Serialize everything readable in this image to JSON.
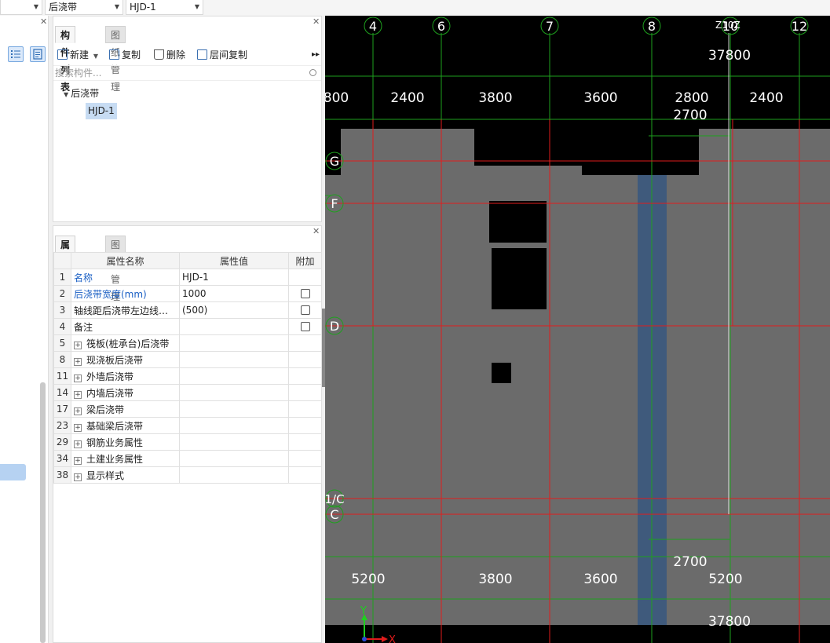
{
  "topbar": {
    "dropdown1": "",
    "dropdown2": "后浇带",
    "dropdown3": "HJD-1"
  },
  "component_panel": {
    "tabs": [
      "构件列表",
      "图纸管理"
    ],
    "toolbar": {
      "new_label": "新建",
      "copy_label": "复制",
      "delete_label": "删除",
      "floor_copy_label": "层间复制"
    },
    "search_placeholder": "搜索构件...",
    "tree_root": "后浇带",
    "tree_child": "HJD-1"
  },
  "property_panel": {
    "tabs": [
      "属性列表",
      "图层管理"
    ],
    "headers": [
      "属性名称",
      "属性值",
      "附加"
    ],
    "rows": [
      {
        "num": "1",
        "name": "名称",
        "value": "HJD-1",
        "checkbox": false,
        "expand": false,
        "blue": true
      },
      {
        "num": "2",
        "name": "后浇带宽度(mm)",
        "value": "1000",
        "checkbox": true,
        "expand": false,
        "blue": true
      },
      {
        "num": "3",
        "name": "轴线距后浇带左边线距...",
        "value": "(500)",
        "checkbox": true,
        "expand": false,
        "blue": false
      },
      {
        "num": "4",
        "name": "备注",
        "value": "",
        "checkbox": true,
        "expand": false,
        "blue": false
      },
      {
        "num": "5",
        "name": "筏板(桩承台)后浇带",
        "value": "",
        "checkbox": false,
        "expand": true,
        "blue": false
      },
      {
        "num": "8",
        "name": "现浇板后浇带",
        "value": "",
        "checkbox": false,
        "expand": true,
        "blue": false
      },
      {
        "num": "11",
        "name": "外墙后浇带",
        "value": "",
        "checkbox": false,
        "expand": true,
        "blue": false
      },
      {
        "num": "14",
        "name": "内墙后浇带",
        "value": "",
        "checkbox": false,
        "expand": true,
        "blue": false
      },
      {
        "num": "17",
        "name": "梁后浇带",
        "value": "",
        "checkbox": false,
        "expand": true,
        "blue": false
      },
      {
        "num": "23",
        "name": "基础梁后浇带",
        "value": "",
        "checkbox": false,
        "expand": true,
        "blue": false
      },
      {
        "num": "29",
        "name": "钢筋业务属性",
        "value": "",
        "checkbox": false,
        "expand": true,
        "blue": false
      },
      {
        "num": "34",
        "name": "土建业务属性",
        "value": "",
        "checkbox": false,
        "expand": true,
        "blue": false
      },
      {
        "num": "38",
        "name": "显示样式",
        "value": "",
        "checkbox": false,
        "expand": true,
        "blue": false
      }
    ]
  },
  "canvas": {
    "axis_labels_top": [
      "4",
      "6",
      "7",
      "8",
      "10",
      "12"
    ],
    "axis_overlap_label": "Z10Z",
    "axis_labels_left": [
      "G",
      "F",
      "D",
      "1/C",
      "C"
    ],
    "total_top": "37800",
    "dims_top": [
      "800",
      "2400",
      "3800",
      "3600",
      "2800",
      "2400"
    ],
    "dim_top_sub": "2700",
    "dims_bottom": [
      "5200",
      "3800",
      "3600",
      "5200"
    ],
    "dim_bottom_sub": "2700",
    "total_bottom": "37800",
    "ucs_y": "Y",
    "ucs_x": "X"
  },
  "colors": {
    "canvas_bg": "#000000",
    "slab_gray": "#6b6b6b",
    "axis_red": "#e11c1c",
    "dim_green": "#1ea01e",
    "post_pour_band": "#3f5a7c"
  }
}
